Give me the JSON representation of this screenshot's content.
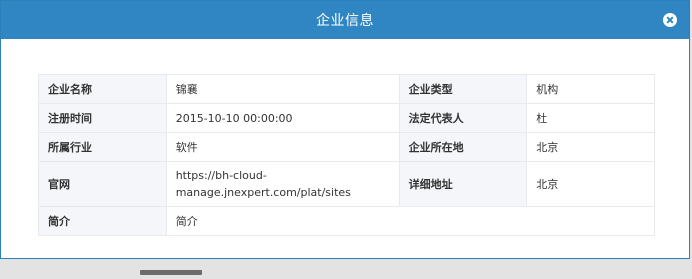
{
  "dialog": {
    "title": "企业信息",
    "close_icon": "close-icon"
  },
  "info": {
    "company_name_label": "企业名称",
    "company_name": "锦襄",
    "company_type_label": "企业类型",
    "company_type": "机构",
    "reg_time_label": "注册时间",
    "reg_time": "2015-10-10 00:00:00",
    "legal_rep_label": "法定代表人",
    "legal_rep": "杜",
    "industry_label": "所属行业",
    "industry": "软件",
    "location_label": "企业所在地",
    "location": "北京",
    "website_label": "官网",
    "website": "https://bh-cloud-manage.jnexpert.com/plat/sites",
    "address_label": "详细地址",
    "address": "北京",
    "intro_label": "简介",
    "intro": "简介"
  },
  "colors": {
    "header": "#2f86c2",
    "label_bg": "#f4f6f9",
    "border": "#e6e9ee"
  }
}
